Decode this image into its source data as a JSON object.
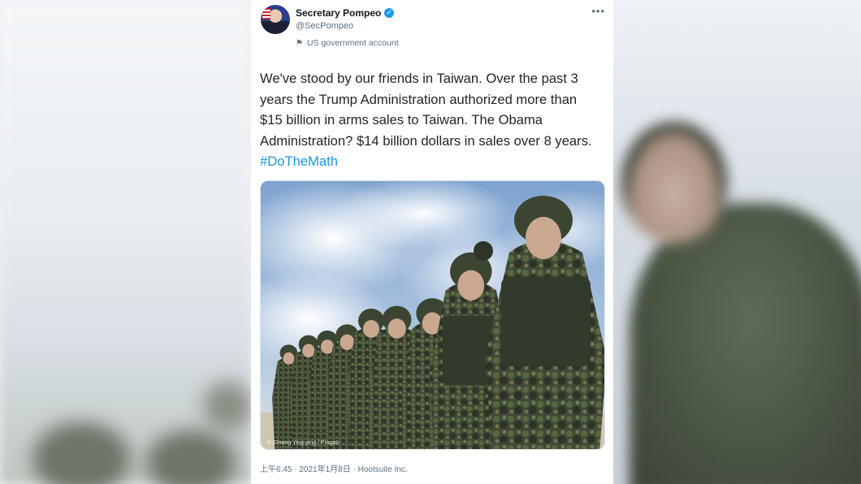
{
  "tweet": {
    "author_name": "Secretary Pompeo",
    "handle": "@SecPompeo",
    "account_label": "US government account",
    "more_icon": "more-icon",
    "text_lines": [
      "We've stood by our friends in Taiwan. Over the past 3",
      "years the Trump Administration authorized more than",
      "$15 billion in arms sales to Taiwan. The Obama",
      "Administration? $14 billion dollars in sales over 8 years."
    ],
    "hashtag": "#DoTheMath",
    "photo_credit": "© Chiang Ying-ying / Pragati",
    "timestamp": "上午6:45 · 2021年1月8日 · Hootsuite Inc."
  },
  "colors": {
    "link": "#1b95e0",
    "verified": "#1d9bf0",
    "secondary_text": "#5b7083"
  }
}
